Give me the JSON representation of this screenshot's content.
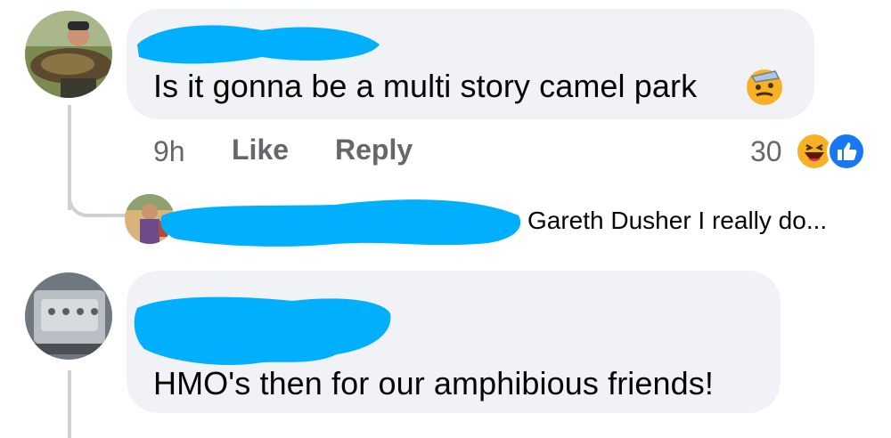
{
  "comments": [
    {
      "text": "Is it gonna be a multi story camel park",
      "emoji": "salute-emoji-icon",
      "time": "9h",
      "like_label": "Like",
      "reply_label": "Reply",
      "reaction_count": "30",
      "reactions": [
        "haha-reaction-icon",
        "like-reaction-icon"
      ]
    },
    {
      "text": "HMO's then for our amphibious friends!"
    }
  ],
  "reply_preview": {
    "text": "Gareth Dusher I really do..."
  },
  "colors": {
    "redaction": "#00b0ff",
    "bubble": "#f0f2f5",
    "meta": "#65676b",
    "like_blue": "#1877f2",
    "haha_yellow": "#f7b125"
  }
}
